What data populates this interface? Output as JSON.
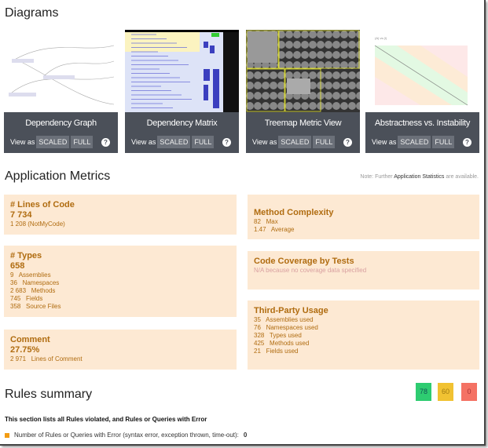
{
  "diagrams": {
    "title": "Diagrams",
    "view_as": "View as",
    "scaled": "SCALED",
    "full": "FULL",
    "help": "?",
    "items": [
      {
        "label": "Dependency Graph"
      },
      {
        "label": "Dependency Matrix"
      },
      {
        "label": "Treemap Metric View"
      },
      {
        "label": "Abstractness vs. Instability"
      }
    ]
  },
  "metrics": {
    "title": "Application Metrics",
    "note_pre": "Note: Further",
    "note_link": "Application Statistics",
    "note_post": "are available.",
    "loc": {
      "title": "# Lines of Code",
      "value": "7 734",
      "sub": "1 208 (NotMyCode)"
    },
    "types": {
      "title": "# Types",
      "value": "658",
      "rows": [
        {
          "n": "9",
          "l": "Assemblies"
        },
        {
          "n": "36",
          "l": "Namespaces"
        },
        {
          "n": "2 683",
          "l": "Methods"
        },
        {
          "n": "745",
          "l": "Fields"
        },
        {
          "n": "358",
          "l": "Source Files"
        }
      ]
    },
    "comment": {
      "title": "Comment",
      "value": "27.75%",
      "rows": [
        {
          "n": "2 971",
          "l": "Lines of Comment"
        }
      ]
    },
    "complexity": {
      "title": "Method Complexity",
      "rows": [
        {
          "n": "82",
          "l": "Max"
        },
        {
          "n": "1.47",
          "l": "Average"
        }
      ]
    },
    "coverage": {
      "title": "Code Coverage by Tests",
      "sub": "N/A because no coverage data specified"
    },
    "thirdparty": {
      "title": "Third-Party Usage",
      "rows": [
        {
          "n": "35",
          "l": "Assemblies used"
        },
        {
          "n": "76",
          "l": "Namespaces used"
        },
        {
          "n": "328",
          "l": "Types used"
        },
        {
          "n": "425",
          "l": "Methods used"
        },
        {
          "n": "21",
          "l": "Fields used"
        }
      ]
    }
  },
  "rules": {
    "title": "Rules summary",
    "badges": [
      {
        "value": "78",
        "color": "#2ecc71"
      },
      {
        "value": "60",
        "color": "#f1c232"
      },
      {
        "value": "0",
        "color": "#f47264"
      }
    ],
    "description": "This section lists all Rules violated, and Rules or Queries with Error",
    "error_label": "Number of Rules or Queries with Error (syntax error, exception thrown, time-out):",
    "error_count": "0"
  }
}
